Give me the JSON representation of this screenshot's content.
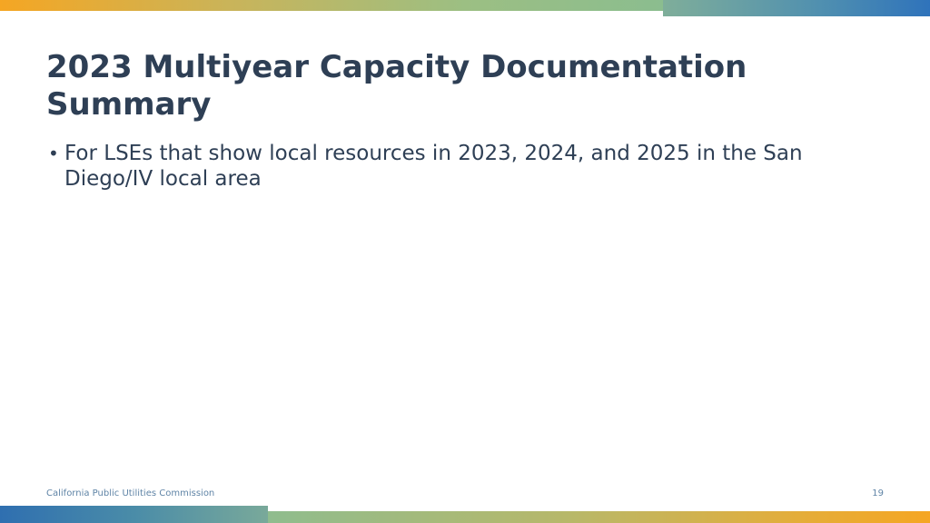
{
  "slide": {
    "title": "2023 Multiyear Capacity Documentation Summary",
    "bullets": [
      "For LSEs that show local resources in 2023, 2024, and 2025 in the San Diego/IV local area"
    ],
    "footer_text": "California Public Utilities Commission",
    "page_number": "19"
  },
  "colors": {
    "title_text": "#2e3f55",
    "footer_text": "#5f84a6",
    "accent_orange": "#f5a623",
    "accent_blue": "#2f73bb",
    "accent_green": "#8bbd8f"
  }
}
